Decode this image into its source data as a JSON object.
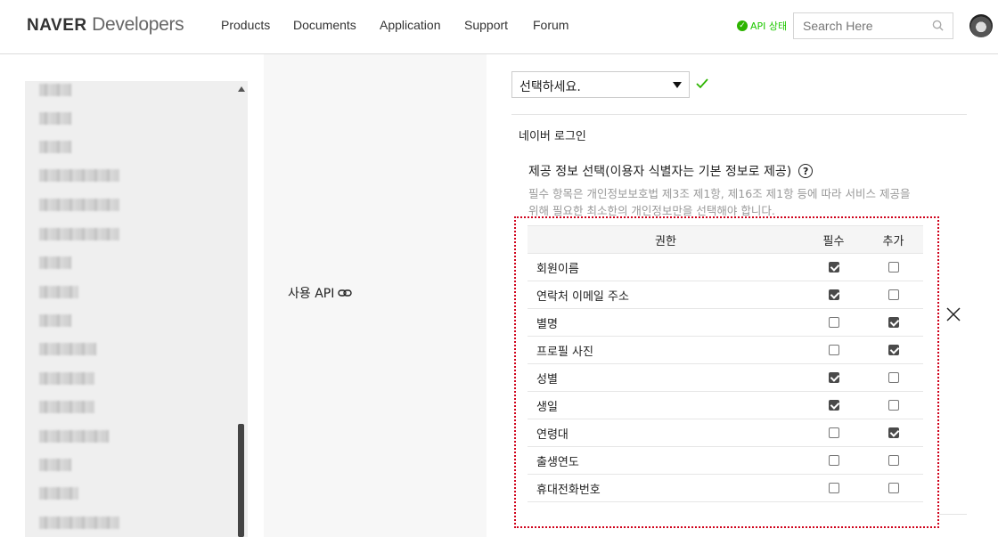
{
  "header": {
    "logo_bold": "NAVER",
    "logo_light": "Developers",
    "nav": [
      "Products",
      "Documents",
      "Application",
      "Support",
      "Forum"
    ],
    "api_status": "API 상태",
    "search_placeholder": "Search Here"
  },
  "form": {
    "select_value": "선택하세요.",
    "use_api_label": "사용 API",
    "section_title": "네이버 로그인",
    "info_title": "제공 정보 선택(이용자 식별자는 기본 정보로 제공)",
    "help_glyph": "?",
    "info_desc": "필수 항목은 개인정보보호법 제3조 제1항, 제16조 제1항 등에 따라 서비스 제공을 위해 필요한 최소한의 개인정보만을 선택해야 합니다."
  },
  "permissions": {
    "headers": [
      "권한",
      "필수",
      "추가"
    ],
    "rows": [
      {
        "name": "회원이름",
        "required": true,
        "additional": false
      },
      {
        "name": "연락처 이메일 주소",
        "required": true,
        "additional": false
      },
      {
        "name": "별명",
        "required": false,
        "additional": true
      },
      {
        "name": "프로필 사진",
        "required": false,
        "additional": true
      },
      {
        "name": "성별",
        "required": true,
        "additional": false
      },
      {
        "name": "생일",
        "required": true,
        "additional": false
      },
      {
        "name": "연령대",
        "required": false,
        "additional": true
      },
      {
        "name": "출생연도",
        "required": false,
        "additional": false
      },
      {
        "name": "휴대전화번호",
        "required": false,
        "additional": false
      }
    ]
  },
  "colors": {
    "accent_green": "#2db400",
    "highlight_red": "#d0021b"
  }
}
